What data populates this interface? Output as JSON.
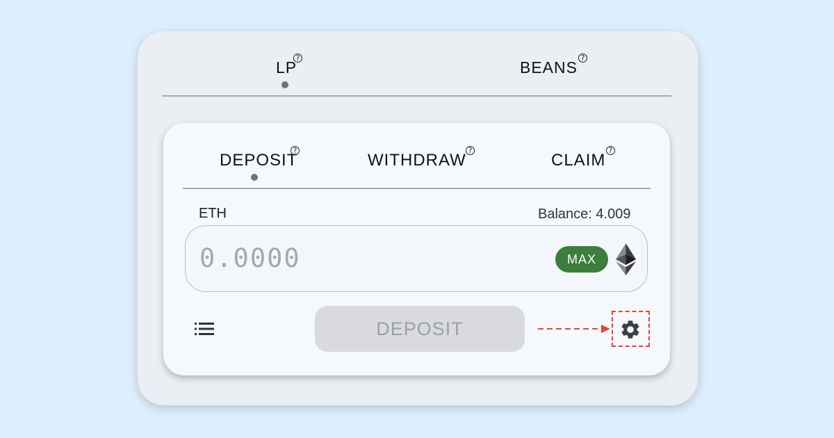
{
  "pool_tabs": [
    {
      "label": "LP",
      "active": true
    },
    {
      "label": "BEANS",
      "active": false
    }
  ],
  "action_tabs": [
    {
      "label": "DEPOSIT",
      "active": true
    },
    {
      "label": "WITHDRAW",
      "active": false
    },
    {
      "label": "CLAIM",
      "active": false
    }
  ],
  "help_glyph": "?",
  "token": {
    "symbol": "ETH",
    "balance_text": "Balance: 4.009",
    "icon": "ethereum-icon"
  },
  "amount_input": {
    "placeholder": "0.0000"
  },
  "max_button": {
    "label": "MAX"
  },
  "submit_button": {
    "label": "DEPOSIT"
  },
  "icons": {
    "list": "list-icon",
    "settings": "gear-icon"
  },
  "colors": {
    "background": "#ddeefc",
    "accent_green": "#3e7d3e",
    "highlight_red": "#e24535"
  }
}
